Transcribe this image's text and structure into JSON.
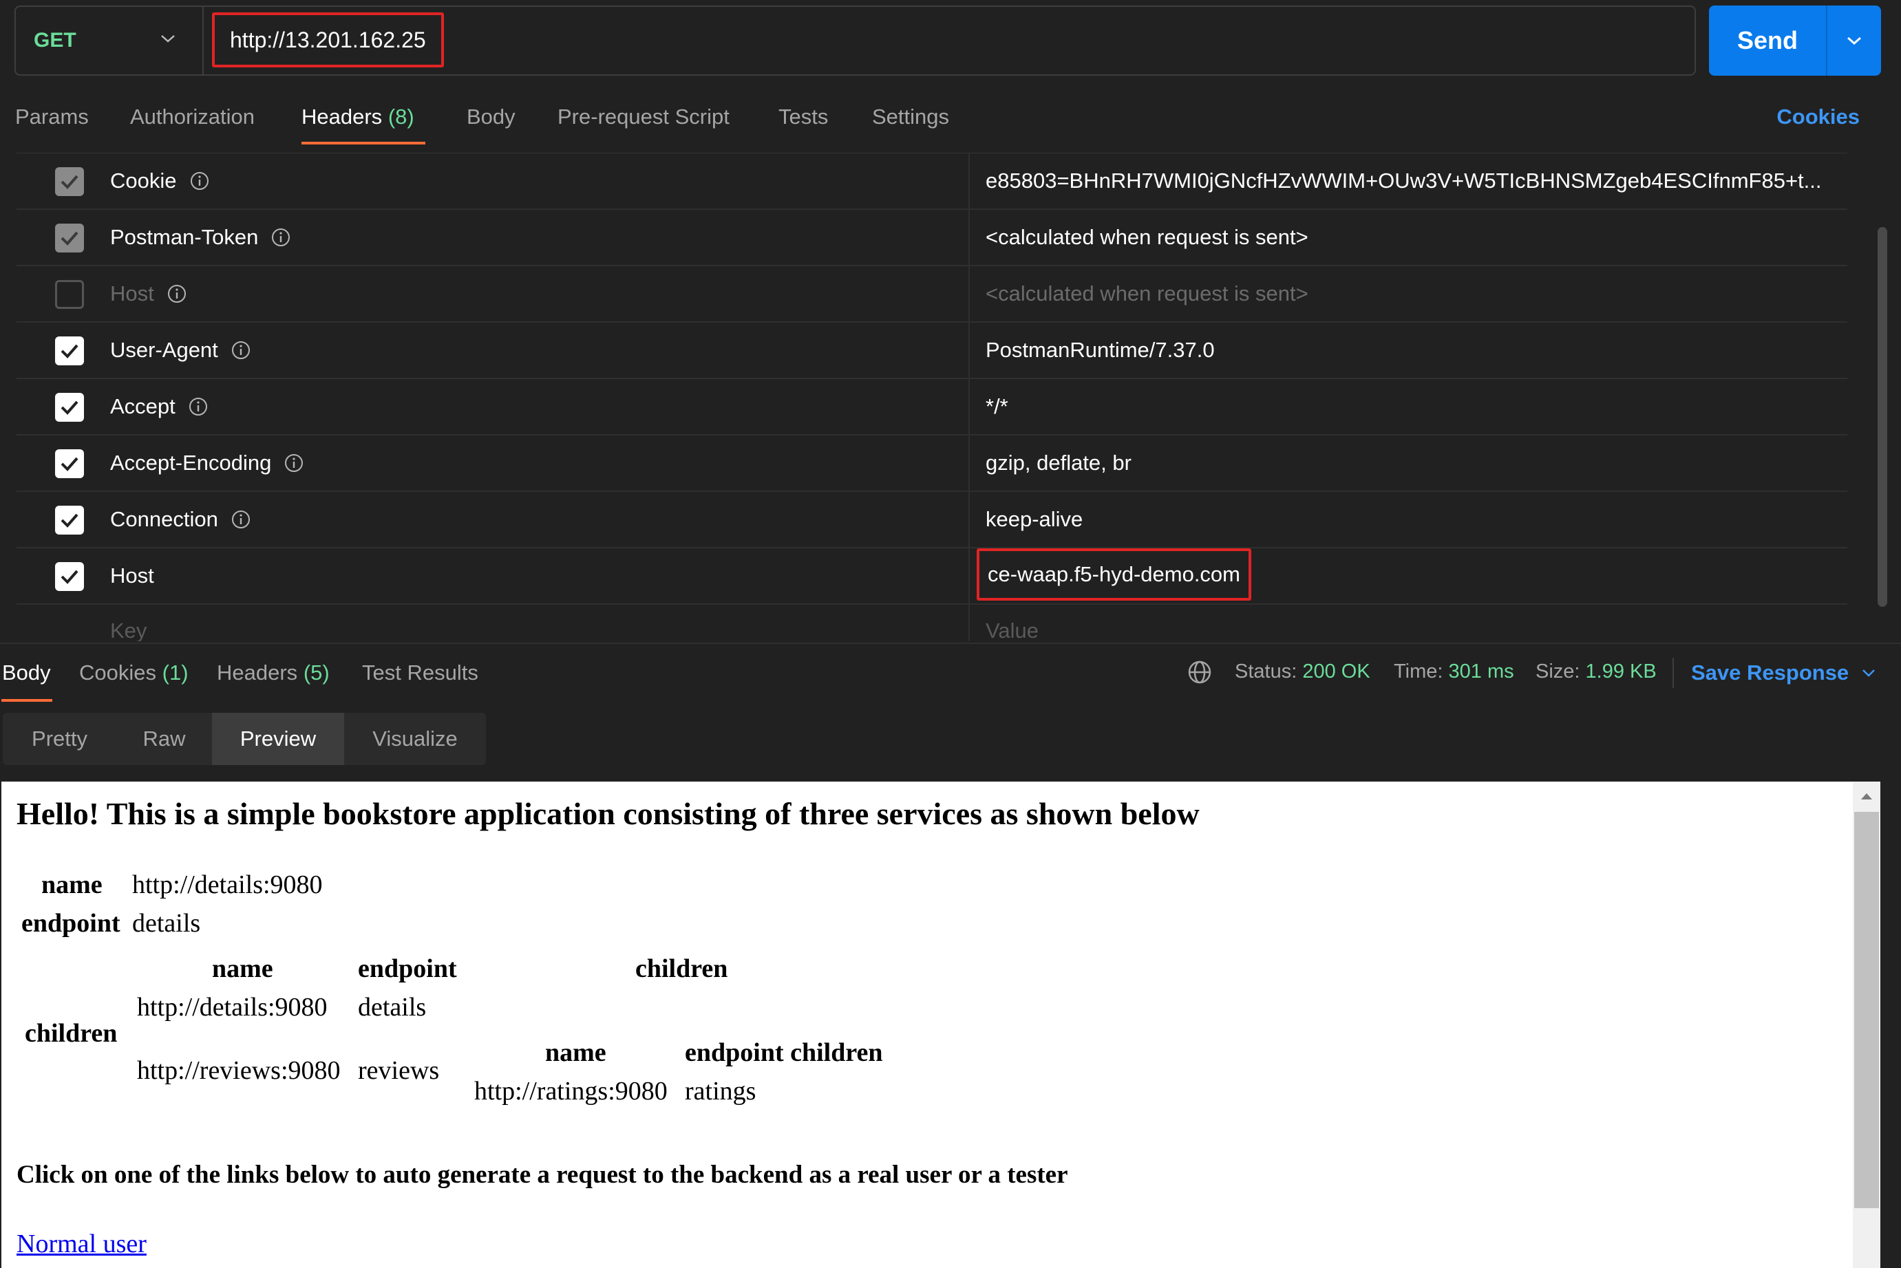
{
  "request": {
    "method": "GET",
    "url": "http://13.201.162.25",
    "send_label": "Send"
  },
  "tabs": [
    {
      "label": "Params"
    },
    {
      "label": "Authorization"
    },
    {
      "label": "Headers",
      "count": "(8)"
    },
    {
      "label": "Body"
    },
    {
      "label": "Pre-request Script"
    },
    {
      "label": "Tests"
    },
    {
      "label": "Settings"
    }
  ],
  "cookies_link": "Cookies",
  "headers": [
    {
      "key": "Cookie",
      "value": "e85803=BHnRH7WMI0jGNcfHZvWWIM+OUw3V+W5TIcBHNSMZgeb4ESCIfnmF85+t...",
      "state": "dim"
    },
    {
      "key": "Postman-Token",
      "value": "<calculated when request is sent>",
      "state": "dim"
    },
    {
      "key": "Host",
      "value": "<calculated when request is sent>",
      "state": "off"
    },
    {
      "key": "User-Agent",
      "value": "PostmanRuntime/7.37.0",
      "state": "on"
    },
    {
      "key": "Accept",
      "value": "*/*",
      "state": "on"
    },
    {
      "key": "Accept-Encoding",
      "value": "gzip, deflate, br",
      "state": "on"
    },
    {
      "key": "Connection",
      "value": "keep-alive",
      "state": "on"
    },
    {
      "key": "Host",
      "value": "ce-waap.f5-hyd-demo.com",
      "state": "on"
    }
  ],
  "new_row": {
    "key_placeholder": "Key",
    "value_placeholder": "Value"
  },
  "response": {
    "tabs": [
      {
        "label": "Body"
      },
      {
        "label": "Cookies",
        "count": "(1)"
      },
      {
        "label": "Headers",
        "count": "(5)"
      },
      {
        "label": "Test Results"
      }
    ],
    "status_label": "Status:",
    "status_value": "200 OK",
    "time_label": "Time:",
    "time_value": "301 ms",
    "size_label": "Size:",
    "size_value": "1.99 KB",
    "save_label": "Save Response",
    "view_modes": [
      "Pretty",
      "Raw",
      "Preview",
      "Visualize"
    ]
  },
  "preview": {
    "heading": "Hello! This is a simple bookstore application consisting of three services as shown below",
    "name_label": "name",
    "name_value": "http://details:9080",
    "endpoint_label": "endpoint",
    "endpoint_value": "details",
    "children_label": "children",
    "child_table": {
      "headers": [
        "name",
        "endpoint",
        "children"
      ],
      "rows": [
        {
          "name": "http://details:9080",
          "endpoint": "details"
        },
        {
          "name": "http://reviews:9080",
          "endpoint": "reviews"
        }
      ],
      "nested": {
        "headers": [
          "name",
          "endpoint children"
        ],
        "name": "http://ratings:9080",
        "endpoint": "ratings"
      }
    },
    "subheading": "Click on one of the links below to auto generate a request to the backend as a real user or a tester",
    "link": "Normal user"
  },
  "colors": {
    "accent": "#ff6c37",
    "send": "#097bed",
    "success": "#6bdd9a",
    "link": "#3d96f5",
    "highlight": "#e02424"
  }
}
